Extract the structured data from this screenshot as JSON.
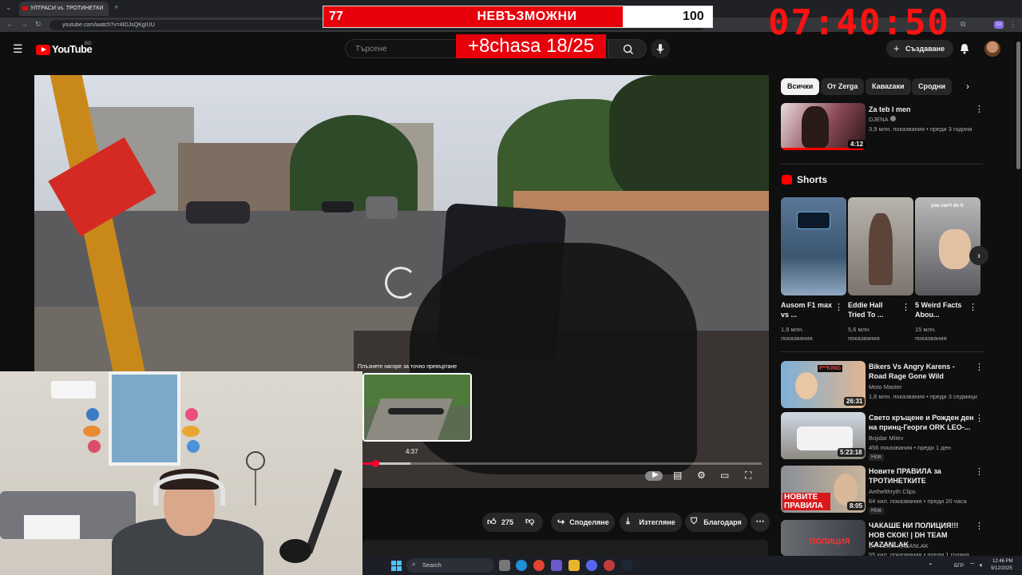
{
  "browser": {
    "tab_title": "УЛТРАСИ vs. ТРОТИНЕТКИ",
    "url": "youtube.com/watch?v=4IDJsQKgIUU"
  },
  "header": {
    "logo_text": "YouTube",
    "logo_region": "BG",
    "search_placeholder": "Търсене",
    "create_label": "Създаване"
  },
  "overlay": {
    "left_number": "77",
    "center_word": "НЕВЪЗМОЖНИ",
    "right_number": "100",
    "progress_fraction": 0.77,
    "subtitle": "+8chasa 18/25",
    "clock": "07:40:50"
  },
  "player": {
    "preview_hint": "Плъзнете нагоре за точно превъртане",
    "preview_time": "4:37",
    "played_fraction": 0.03,
    "buffered_fraction": 0.12
  },
  "actions": {
    "like_count": "275",
    "share_label": "Споделяне",
    "download_label": "Изтегляне",
    "thanks_label": "Благодаря"
  },
  "sidebar": {
    "chips": [
      "Всички",
      "От Zerga",
      "Каваzaки",
      "Сродни"
    ],
    "top_video": {
      "title": "Za teb I men",
      "channel": "DJENA",
      "meta": "3,9 млн. показвания • преди 3 години",
      "duration": "4:12"
    },
    "shorts_title": "Shorts",
    "shorts": [
      {
        "title": "Ausom F1 max vs ...",
        "views": "1,9 млн. показвания"
      },
      {
        "title": "Eddie Hall Tried To ...",
        "views": "5,6 млн. показвания"
      },
      {
        "title": "5 Weird Facts Abou...",
        "views": "15 млн. показвания"
      }
    ],
    "shorts_overlay_text": "you can't do it",
    "videos": [
      {
        "title": "Bikers Vs Angry Karens - Road Rage Gone Wild",
        "channel": "Moto Master",
        "meta": "1,6 млн. показвания • преди 3 седмици",
        "duration": "26:31",
        "badge": "",
        "thumb_text": "F**KING"
      },
      {
        "title": "Свето кръщене и Рожден ден на принц-Георги ORK LEO-...",
        "channel": "Bojidar Mitev",
        "meta": "456 показвания • преди 1 ден",
        "duration": "5:23:18",
        "badge": "Нов",
        "thumb_text": ""
      },
      {
        "title": "Новите ПРАВИЛА за ТРОТИНЕТКИТЕ",
        "channel": "Aethelthryth Clips",
        "meta": "64 хил. показвания • преди 20 часа",
        "duration": "8:05",
        "badge": "Нов",
        "thumb_text": "НОВИТЕ ПРАВИЛА"
      },
      {
        "title": "ЧАКАШЕ НИ ПОЛИЦИЯ!!! НОВ СКОК! | DH TEAM KAZANLAK",
        "channel": "DH TEAM KAZANLAK",
        "meta": "55 хил. показвания • преди 1 година",
        "duration": "",
        "badge": "",
        "thumb_text": "ПОЛИЦИЯ"
      }
    ]
  },
  "taskbar": {
    "search_label": "Search",
    "lang": "БГР",
    "time": "12:46 PM",
    "date": "9/12/2025"
  },
  "colors": {
    "accent": "#ff0000",
    "overlay_red": "#e8000b",
    "clock_red": "#ff1111",
    "bg": "#0f0f0f"
  }
}
